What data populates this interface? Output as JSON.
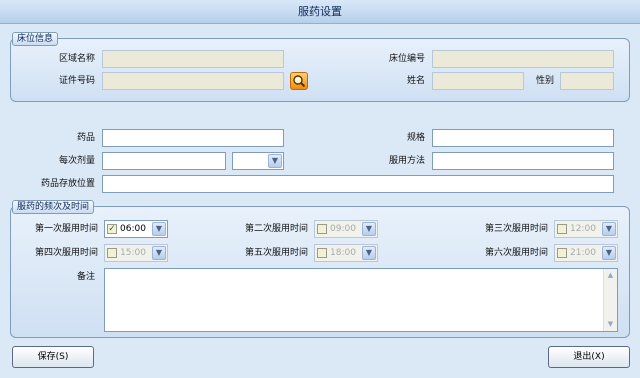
{
  "window": {
    "title": "服药设置"
  },
  "bed_info": {
    "legend": "床位信息",
    "area_name_label": "区域名称",
    "area_name_value": "",
    "bed_no_label": "床位编号",
    "bed_no_value": "",
    "id_no_label": "证件号码",
    "id_no_value": "",
    "name_label": "姓名",
    "name_value": "",
    "gender_label": "性别",
    "gender_value": ""
  },
  "medicine": {
    "drug_label": "药品",
    "drug_value": "",
    "spec_label": "规格",
    "spec_value": "",
    "dose_label": "每次剂量",
    "dose_value": "",
    "unit_value": "",
    "method_label": "服用方法",
    "method_value": "",
    "location_label": "药品存放位置",
    "location_value": ""
  },
  "schedule": {
    "legend": "服药的频次及时间",
    "times": [
      {
        "label": "第一次服用时间",
        "time": "06:00",
        "checked": true
      },
      {
        "label": "第二次服用时间",
        "time": "09:00",
        "checked": false
      },
      {
        "label": "第三次服用时间",
        "time": "12:00",
        "checked": false
      },
      {
        "label": "第四次服用时间",
        "time": "15:00",
        "checked": false
      },
      {
        "label": "第五次服用时间",
        "time": "18:00",
        "checked": false
      },
      {
        "label": "第六次服用时间",
        "time": "21:00",
        "checked": false
      }
    ],
    "notes_label": "备注",
    "notes_value": ""
  },
  "buttons": {
    "save_label": "保存(S)",
    "exit_label": "退出(X)"
  }
}
